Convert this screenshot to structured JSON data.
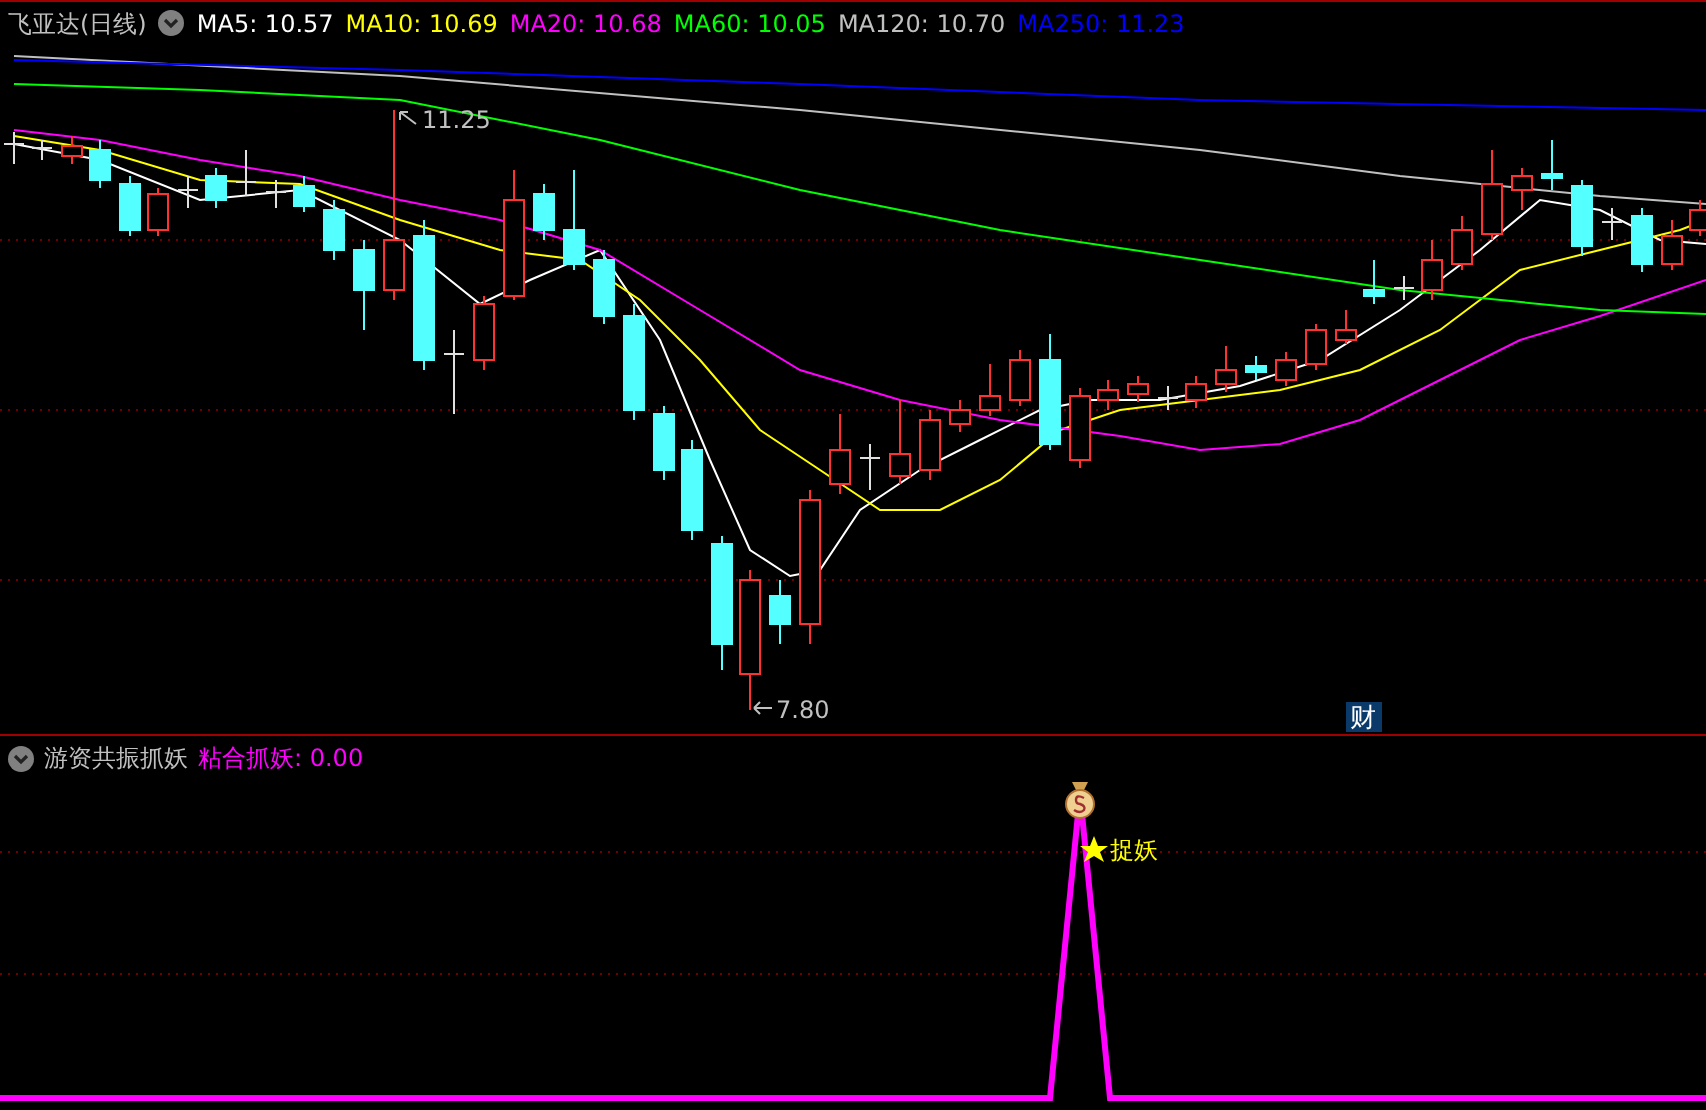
{
  "header": {
    "stock_name": "飞亚达(日线)",
    "indicators": [
      {
        "label": "MA5: 10.57",
        "color": "#ffffff"
      },
      {
        "label": "MA10: 10.69",
        "color": "#ffff00"
      },
      {
        "label": "MA20: 10.68",
        "color": "#ff00ff"
      },
      {
        "label": "MA60: 10.05",
        "color": "#00ff00"
      },
      {
        "label": "MA120: 10.70",
        "color": "#c0c0c0"
      },
      {
        "label": "MA250: 11.23",
        "color": "#0000ff"
      }
    ]
  },
  "price_panel": {
    "high_label": "11.25",
    "low_label": "7.80",
    "badge": "财"
  },
  "indicator_panel": {
    "name": "游资共振抓妖",
    "series": {
      "label": "粘合抓妖: 0.00",
      "color": "#ff00ff"
    },
    "signal_label": "捉妖"
  }
}
